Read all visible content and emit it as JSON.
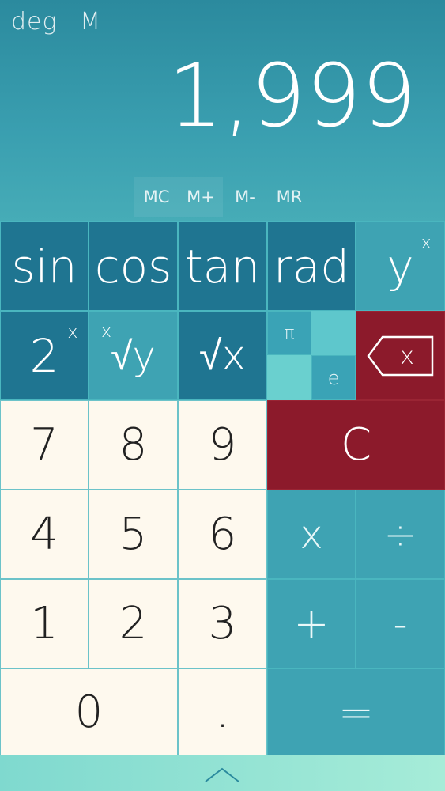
{
  "status": {
    "angle_mode": "deg",
    "memory_flag": "M"
  },
  "display": {
    "value": "1,999"
  },
  "memory": {
    "mc": "MC",
    "mplus": "M+",
    "mminus": "M-",
    "mr": "MR"
  },
  "keys": {
    "sin": "sin",
    "cos": "cos",
    "tan": "tan",
    "rad": "rad",
    "pow_base": "y",
    "pow_exp": "x",
    "two_base": "2",
    "two_exp": "x",
    "root_index": "x",
    "root_sym": "√y",
    "sqrt": "√x",
    "pi": "π",
    "e": "e",
    "backspace_x": "x",
    "seven": "7",
    "eight": "8",
    "nine": "9",
    "clear": "C",
    "four": "4",
    "five": "5",
    "six": "6",
    "multiply": "x",
    "divide": "÷",
    "one": "1",
    "two": "2",
    "three": "3",
    "plus": "+",
    "minus": "-",
    "zero": "0",
    "dot": ".",
    "equals": "="
  },
  "colors": {
    "dark": "#1f7591",
    "teal": "#3ea3b3",
    "red": "#8c1a2b",
    "cream": "#fef9ee"
  },
  "icons": {
    "backspace": "backspace-icon",
    "expand": "chevron-up-icon"
  }
}
